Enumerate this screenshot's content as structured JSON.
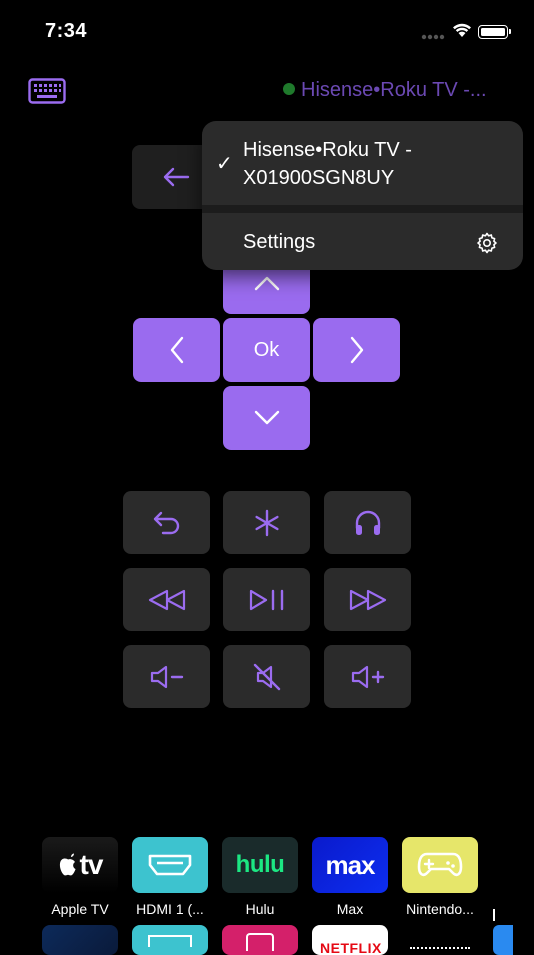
{
  "status_bar": {
    "time": "7:34"
  },
  "header": {
    "device_name": "Hisense•Roku TV -..."
  },
  "dropdown": {
    "device_line1": "Hisense•Roku TV -",
    "device_line2": "X01900SGN8UY",
    "checkmark": "✓",
    "settings_label": "Settings"
  },
  "dpad": {
    "ok_label": "Ok"
  },
  "icons": {
    "keyboard": "keyboard-icon",
    "back": "arrow-left-icon",
    "up": "chevron-up-icon",
    "down": "chevron-down-icon",
    "left": "chevron-left-icon",
    "right": "chevron-right-icon",
    "replay": "replay-icon",
    "options": "asterisk-icon",
    "headphones": "headphones-icon",
    "rewind": "rewind-icon",
    "play_pause": "play-pause-icon",
    "fast_forward": "fast-forward-icon",
    "volume_down": "volume-down-icon",
    "mute": "mute-icon",
    "volume_up": "volume-up-icon",
    "gear": "gear-icon"
  },
  "colors": {
    "accent": "#9a6bef",
    "icon_purple": "#9b6cf0",
    "button_dark": "#2b2b2b",
    "connected": "#1f7a2c"
  },
  "apps": [
    {
      "label": "Apple TV",
      "tile_text": "tv"
    },
    {
      "label": "HDMI 1 (..."
    },
    {
      "label": "Hulu",
      "tile_text": "hulu"
    },
    {
      "label": "Max",
      "tile_text": "max"
    },
    {
      "label": "Nintendo..."
    }
  ],
  "apps_row2": {
    "netflix_partial": "NETFLIX"
  }
}
